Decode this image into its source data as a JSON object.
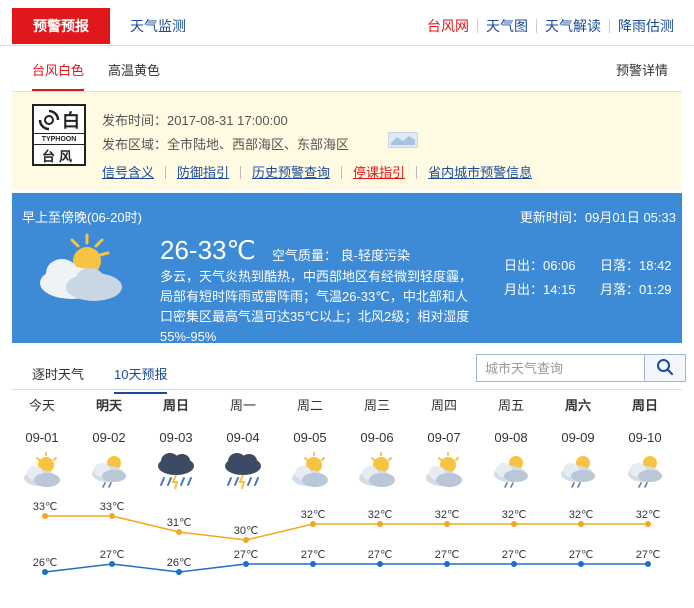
{
  "topnav": {
    "warning_tab": "预警预报",
    "monitor_tab": "天气监测",
    "links": [
      "台风网",
      "天气图",
      "天气解读",
      "降雨估测"
    ]
  },
  "subtabs": {
    "typhoon": "台风白色",
    "heat": "高温黄色",
    "detail": "预警详情"
  },
  "warning": {
    "signal_char": "白",
    "signal_en": "TYPHOON",
    "signal_cn": "台风",
    "issue_time": "发布时间：2017-08-31 17:00:00",
    "issue_area": "发布区域：全市陆地、西部海区、东部海区",
    "links": [
      {
        "label": "信号含义",
        "red": false
      },
      {
        "label": "防御指引",
        "red": false
      },
      {
        "label": "历史预警查询",
        "red": false
      },
      {
        "label": "停课指引",
        "red": true
      },
      {
        "label": "省内城市预警信息",
        "red": false
      }
    ]
  },
  "today": {
    "period": "早上至傍晚(06-20时)",
    "update_time": "更新时间：09月01日 05:33",
    "temp": "26-33℃",
    "air_quality": "空气质量： 良-轻度污染",
    "description": "多云，天气炎热到酷热，中西部地区有经微到轻度霾，局部有短时阵雨或雷阵雨；气温26-33℃，中北部和人口密集区最高气温可达35℃以上；北风2级；相对湿度55%-95%",
    "sunrise": "日出：06:06",
    "sunset": "日落：18:42",
    "moonrise": "月出：14:15",
    "moonset": "月落：01:29",
    "icon": "partly-cloudy-icon"
  },
  "forecast_tabs": {
    "hourly": "逐时天气",
    "ten_day": "10天预报",
    "search_placeholder": "城市天气查询"
  },
  "days": [
    {
      "week": "今天",
      "date": "09-01",
      "icon": "partly-cloudy-icon",
      "bold": false
    },
    {
      "week": "明天",
      "date": "09-02",
      "icon": "partly-cloudy-shower-icon",
      "bold": true
    },
    {
      "week": "周日",
      "date": "09-03",
      "icon": "thunderstorm-icon",
      "bold": true
    },
    {
      "week": "周一",
      "date": "09-04",
      "icon": "thunderstorm-icon",
      "bold": false
    },
    {
      "week": "周二",
      "date": "09-05",
      "icon": "partly-cloudy-icon",
      "bold": false
    },
    {
      "week": "周三",
      "date": "09-06",
      "icon": "partly-cloudy-icon",
      "bold": false
    },
    {
      "week": "周四",
      "date": "09-07",
      "icon": "partly-cloudy-icon",
      "bold": false
    },
    {
      "week": "周五",
      "date": "09-08",
      "icon": "partly-cloudy-shower-icon",
      "bold": false
    },
    {
      "week": "周六",
      "date": "09-09",
      "icon": "partly-cloudy-shower-icon",
      "bold": true
    },
    {
      "week": "周日",
      "date": "09-10",
      "icon": "partly-cloudy-shower-icon",
      "bold": true
    }
  ],
  "chart_data": {
    "type": "line",
    "categories": [
      "09-01",
      "09-02",
      "09-03",
      "09-04",
      "09-05",
      "09-06",
      "09-07",
      "09-08",
      "09-09",
      "09-10"
    ],
    "series": [
      {
        "values": [
          33,
          33,
          31,
          30,
          32,
          32,
          32,
          32,
          32,
          32
        ],
        "color": "#f5a623"
      },
      {
        "values": [
          26,
          27,
          26,
          27,
          27,
          27,
          27,
          27,
          27,
          27
        ],
        "color": "#1e6fc7"
      }
    ],
    "unit": "℃",
    "ylim": [
      24,
      35
    ]
  }
}
